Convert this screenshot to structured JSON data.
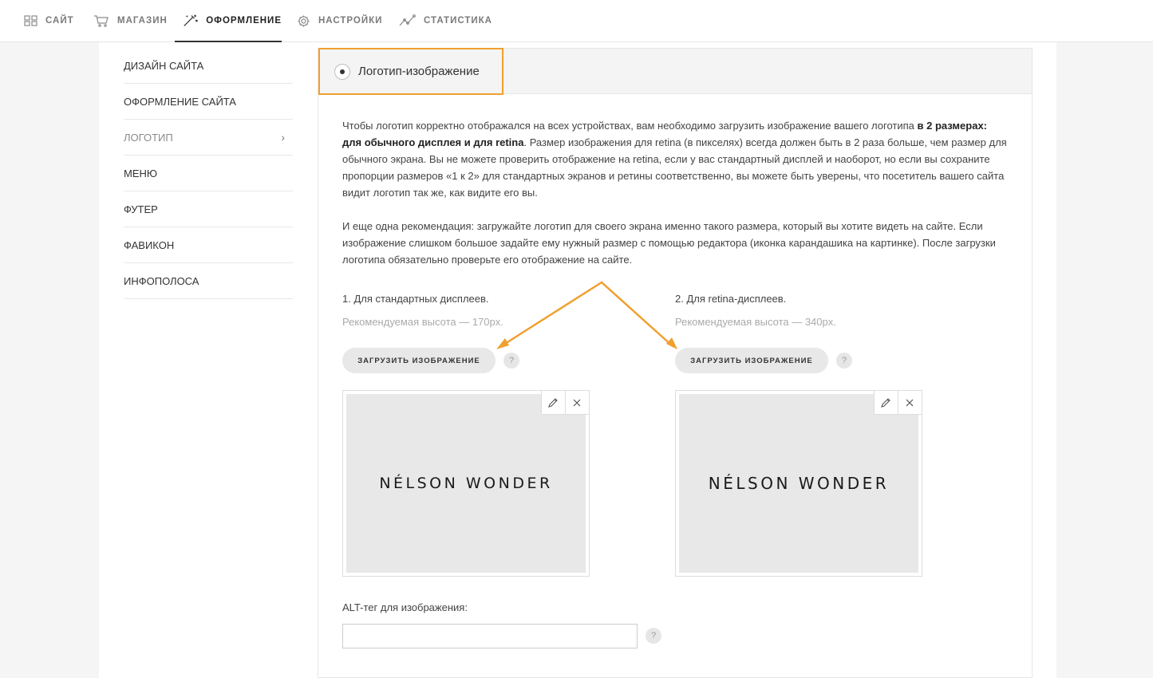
{
  "nav": [
    {
      "label": "САЙТ",
      "icon": "grid-icon",
      "active": false
    },
    {
      "label": "МАГАЗИН",
      "icon": "cart-icon",
      "active": false
    },
    {
      "label": "ОФОРМЛЕНИЕ",
      "icon": "magic-wand-icon",
      "active": true
    },
    {
      "label": "НАСТРОЙКИ",
      "icon": "gear-icon",
      "active": false
    },
    {
      "label": "СТАТИСТИКА",
      "icon": "chart-line-icon",
      "active": false
    }
  ],
  "sidebar": {
    "items": [
      {
        "label": "ДИЗАЙН САЙТА"
      },
      {
        "label": "ОФОРМЛЕНИЕ САЙТА"
      },
      {
        "label": "ЛОГОТИП",
        "active": true
      },
      {
        "label": "МЕНЮ"
      },
      {
        "label": "ФУТЕР"
      },
      {
        "label": "ФАВИКОН"
      },
      {
        "label": "ИНФОПОЛОСА"
      }
    ]
  },
  "panel": {
    "option_label": "Логотип-изображение",
    "intro_before": "Чтобы логотип корректно отображался на всех устройствах, вам необходимо загрузить изображение вашего логотипа ",
    "intro_bold": "в 2 размерах: для обычного дисплея и для retina",
    "intro_after": ". Размер изображения для retina (в пикселях) всегда должен быть в 2 раза больше, чем размер для обычного экрана. Вы не можете проверить отображение на retina, если у вас стандартный дисплей и наоборот, но если вы сохраните пропорции размеров «1 к 2» для стандартных экранов и ретины соответственно, вы можете быть уверены, что посетитель вашего сайта видит логотип так же, как видите его вы.",
    "recommendation": "И еще одна рекомендация: загружайте логотип для своего экрана именно такого размера, который вы хотите видеть на сайте. Если изображение слишком большое задайте ему нужный размер с помощью редактора (иконка карандашика на картинке). После загрузки логотипа обязательно проверьте его отображение на сайте.",
    "columns": [
      {
        "title": "1. Для стандартных дисплеев.",
        "hint": "Рекомендуемая высота — 170px.",
        "button": "ЗАГРУЗИТЬ ИЗОБРАЖЕНИЕ",
        "help": "?",
        "logo_text": "NÉLSON WONDER"
      },
      {
        "title": "2. Для retina-дисплеев.",
        "hint": "Рекомендуемая высота — 340px.",
        "button": "ЗАГРУЗИТЬ ИЗОБРАЖЕНИЕ",
        "help": "?",
        "logo_text": "NÉLSON WONDER"
      }
    ],
    "alt_label": "ALT-тег для изображения:",
    "alt_value": "",
    "alt_help": "?"
  },
  "colors": {
    "accent_orange": "#f0a030",
    "nav_active": "#222222",
    "nav_inactive": "#7a7a7a"
  }
}
